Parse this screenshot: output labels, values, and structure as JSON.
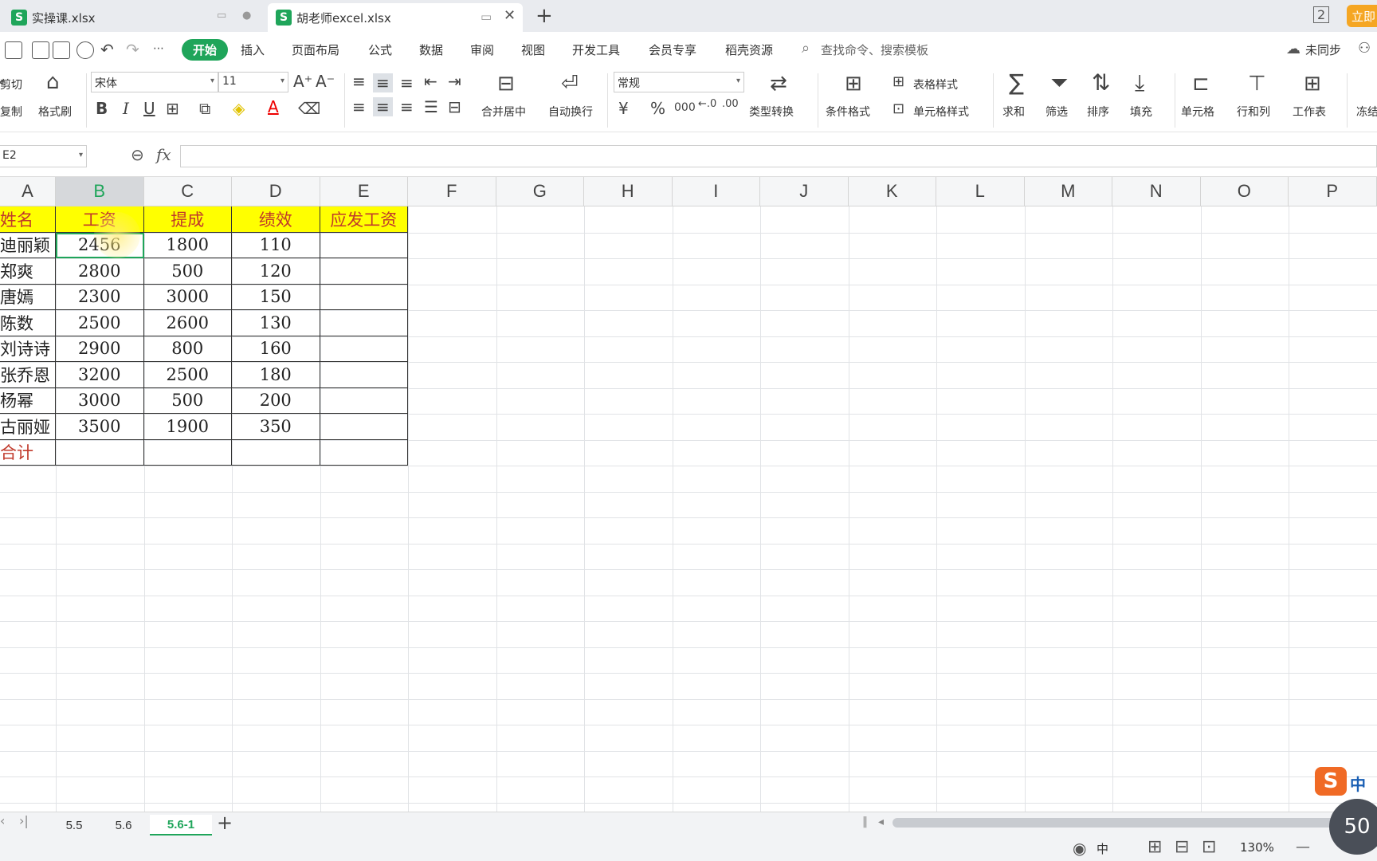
{
  "file_tabs": [
    {
      "label": "实操课.xlsx",
      "active": false
    },
    {
      "label": "胡老师excel.xlsx",
      "active": true
    }
  ],
  "top_right_button": "立即",
  "quick_access_more": "⋯",
  "menu": {
    "items": [
      "开始",
      "插入",
      "页面布局",
      "公式",
      "数据",
      "审阅",
      "视图",
      "开发工具",
      "会员专享",
      "稻壳资源"
    ],
    "search": "查找命令、搜索模板",
    "sync": "未同步"
  },
  "ribbon": {
    "cut": "剪切",
    "copy": "复制",
    "format_painter": "格式刷",
    "font_name": "宋体",
    "font_size": "11",
    "merge_center": "合并居中",
    "wrap_text": "自动换行",
    "number_format": "常规",
    "type_convert": "类型转换",
    "conditional_format": "条件格式",
    "table_style": "表格样式",
    "cell_style": "单元格样式",
    "sum": "求和",
    "filter": "筛选",
    "sort": "排序",
    "fill": "填充",
    "cells": "单元格",
    "rows_cols": "行和列",
    "worksheet": "工作表",
    "freeze": "冻结",
    "bold": "B",
    "italic": "I",
    "underline": "U",
    "font_color": "A",
    "currency": "¥",
    "percent": "%",
    "thousands": "000"
  },
  "formula_bar": {
    "name_box": "E2",
    "fx": "fx",
    "value": ""
  },
  "columns": [
    "A",
    "B",
    "C",
    "D",
    "E",
    "F",
    "G",
    "H",
    "I",
    "J",
    "K",
    "L",
    "M",
    "N",
    "O",
    "P"
  ],
  "active_column": "B",
  "table": {
    "header": [
      "姓名",
      "工资",
      "提成",
      "绩效",
      "应发工资"
    ],
    "rows": [
      [
        "迪丽颖",
        "2456",
        "1800",
        "110",
        ""
      ],
      [
        "郑爽",
        "2800",
        "500",
        "120",
        ""
      ],
      [
        "唐嫣",
        "2300",
        "3000",
        "150",
        ""
      ],
      [
        "陈数",
        "2500",
        "2600",
        "130",
        ""
      ],
      [
        "刘诗诗",
        "2900",
        "800",
        "160",
        ""
      ],
      [
        "张乔恩",
        "3200",
        "2500",
        "180",
        ""
      ],
      [
        "杨幂",
        "3000",
        "500",
        "200",
        ""
      ],
      [
        "古丽娅",
        "3500",
        "1900",
        "350",
        ""
      ]
    ],
    "total_label": "合计"
  },
  "sheet_tabs": [
    {
      "label": "5.5",
      "active": false
    },
    {
      "label": "5.6",
      "active": false
    },
    {
      "label": "5.6-1",
      "active": true
    }
  ],
  "status": {
    "input_method": "中",
    "zoom": "130%",
    "badge": "50"
  },
  "ime": {
    "logo": "S",
    "mode": "中"
  },
  "colors": {
    "accent": "#1fa55a",
    "header_fill": "#ffff00",
    "header_text": "#c0392b"
  }
}
